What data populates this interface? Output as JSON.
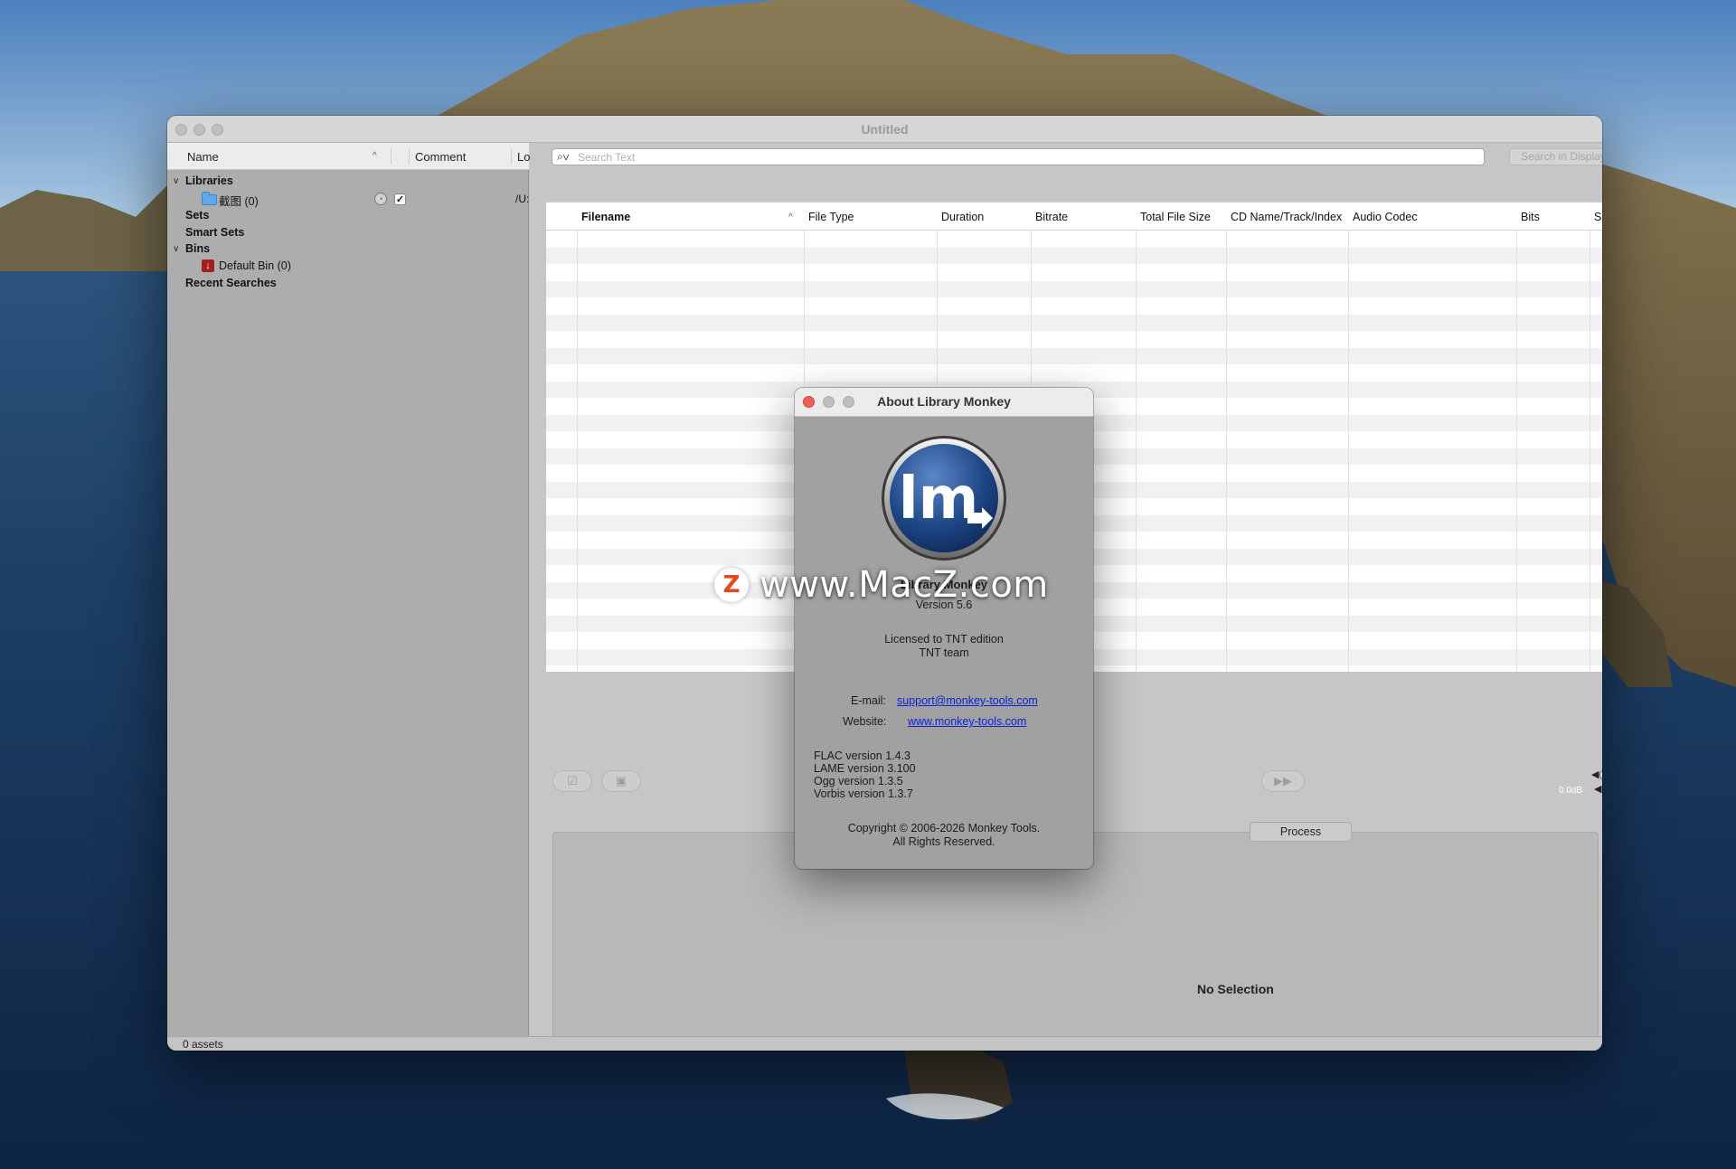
{
  "window": {
    "title": "Untitled"
  },
  "sidebar": {
    "columns": [
      "Name",
      "Comment",
      "Lo"
    ],
    "libraries_label": "Libraries",
    "library_item": "截图 (0)",
    "library_location": "/U:",
    "sets_label": "Sets",
    "smart_sets_label": "Smart Sets",
    "bins_label": "Bins",
    "bin_item": "Default Bin (0)",
    "recent_searches_label": "Recent Searches"
  },
  "search": {
    "placeholder": "Search Text",
    "button_label": "Search in Displayed Assets"
  },
  "table": {
    "columns": [
      "Filename",
      "File Type",
      "Duration",
      "Bitrate",
      "Total File Size",
      "CD Name/Track/Index",
      "Audio Codec",
      "Bits",
      "S"
    ]
  },
  "player": {
    "gain_label": "0.0dB"
  },
  "detail": {
    "tab_process": "Process",
    "empty_text": "No Selection"
  },
  "status": {
    "asset_count": "0 assets"
  },
  "about": {
    "title": "About Library Monkey",
    "product_name": "Library Monkey",
    "version": "Version 5.6",
    "license_line1": "Licensed to TNT edition",
    "license_line2": "TNT team",
    "email_label": "E-mail:",
    "email_value": "support@monkey-tools.com",
    "website_label": "Website:",
    "website_value": "www.monkey-tools.com",
    "flac_version": "FLAC version 1.4.3",
    "lame_version": "LAME version 3.100",
    "ogg_version": "Ogg version 1.3.5",
    "vorbis_version": "Vorbis version 1.3.7",
    "copyright": "Copyright © 2006-2026 Monkey Tools.",
    "rights": "All Rights Reserved.",
    "logo_letters": "lm"
  },
  "watermark": {
    "badge": "Z",
    "text": "www.MacZ.com"
  }
}
